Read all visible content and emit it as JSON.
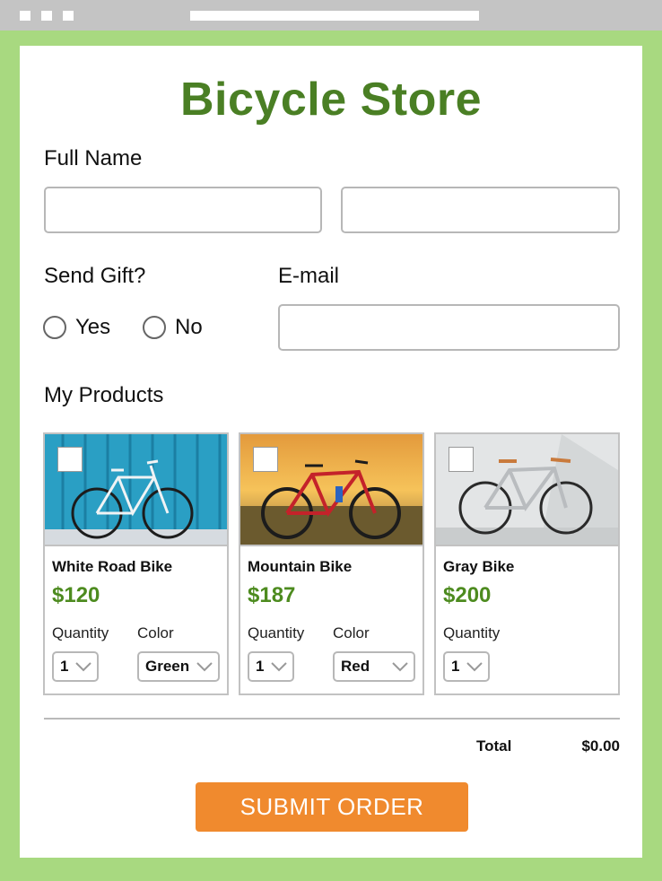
{
  "page_title": "Bicycle Store",
  "form": {
    "full_name_label": "Full Name",
    "first_name_value": "",
    "last_name_value": "",
    "gift_label": "Send Gift?",
    "gift_options": [
      "Yes",
      "No"
    ],
    "email_label": "E-mail",
    "email_value": "",
    "products_label": "My Products"
  },
  "products": [
    {
      "name": "White Road Bike",
      "price": "$120",
      "quantity_label": "Quantity",
      "quantity_value": "1",
      "color_label": "Color",
      "color_value": "Green",
      "photo": "white-road-bike-blue-wall"
    },
    {
      "name": "Mountain Bike",
      "price": "$187",
      "quantity_label": "Quantity",
      "quantity_value": "1",
      "color_label": "Color",
      "color_value": "Red",
      "photo": "red-bike-sunset-field"
    },
    {
      "name": "Gray Bike",
      "price": "$200",
      "quantity_label": "Quantity",
      "quantity_value": "1",
      "photo": "gray-bike-white-wall"
    }
  ],
  "summary": {
    "total_label": "Total",
    "total_value": "$0.00"
  },
  "submit_label": "SUBMIT ORDER",
  "colors": {
    "background": "#a8d980",
    "title": "#4a7f24",
    "price": "#4d8b1f",
    "button": "#f08a2e"
  },
  "icons": [
    "checkbox-icon",
    "chevron-down-icon",
    "radio-icon"
  ]
}
